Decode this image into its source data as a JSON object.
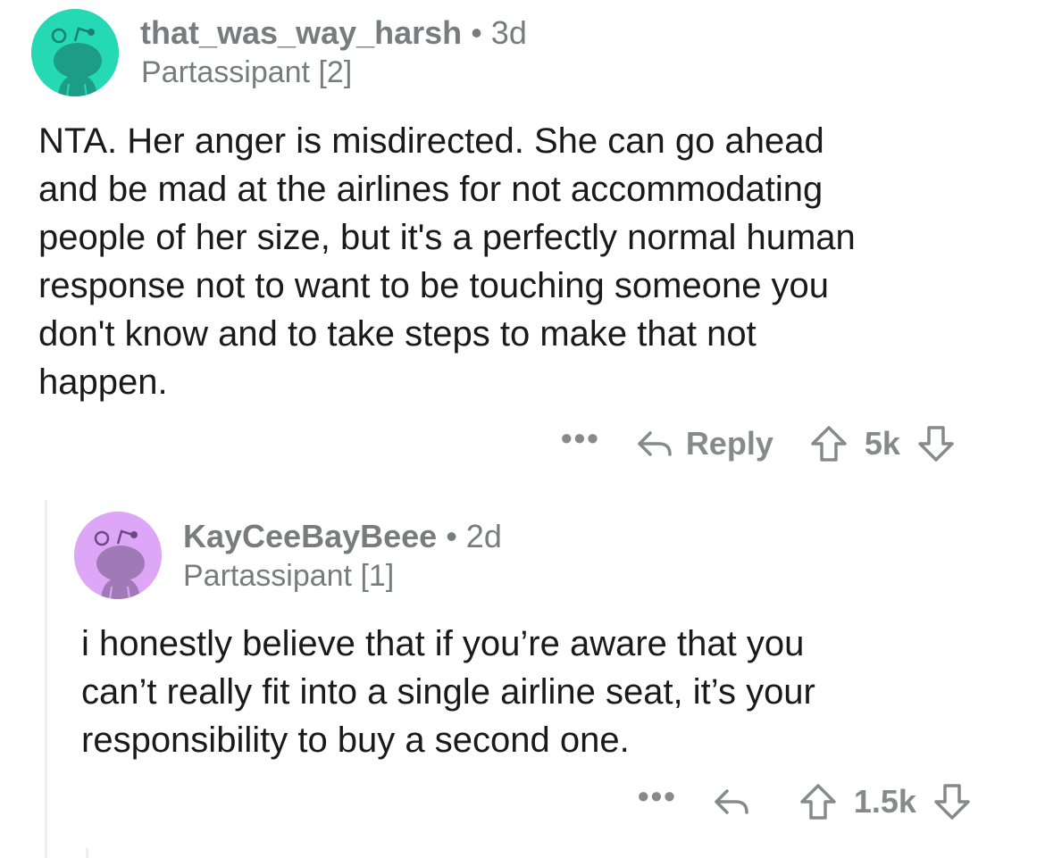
{
  "comments": [
    {
      "username": "that_was_way_harsh",
      "separator": "•",
      "age": "3d",
      "flair": "Partassipant [2]",
      "avatar_color": "#24d9b4",
      "body_lines": [
        "NTA. Her anger is misdirected. She can go ahead",
        "and be mad at the airlines for not accommodating",
        "people of her size, but it's a perfectly normal human",
        "response not to want to be touching someone you",
        "don't know and to take steps to make that not",
        "happen."
      ],
      "actions": {
        "more": "•••",
        "reply_label": "Reply",
        "score": "5k"
      }
    },
    {
      "username": "KayCeeBayBeee",
      "separator": "•",
      "age": "2d",
      "flair": "Partassipant [1]",
      "avatar_color": "#dda6f7",
      "body_lines": [
        "i honestly believe that if you’re aware that you",
        "can’t really fit into a single airline seat, it’s your",
        "responsibility to buy a second one."
      ],
      "actions": {
        "more": "•••",
        "score": "1.5k"
      }
    }
  ],
  "icons": {
    "reply": "reply-arrow-icon",
    "upvote": "upvote-arrow-icon",
    "downvote": "downvote-arrow-icon",
    "more": "ellipsis-icon",
    "avatar": "snoo-avatar-icon"
  },
  "colors": {
    "meta_text": "#787c7e",
    "action_text": "#878a8c",
    "body_text": "#1a1a1b",
    "thread_line": "#edeff1"
  }
}
